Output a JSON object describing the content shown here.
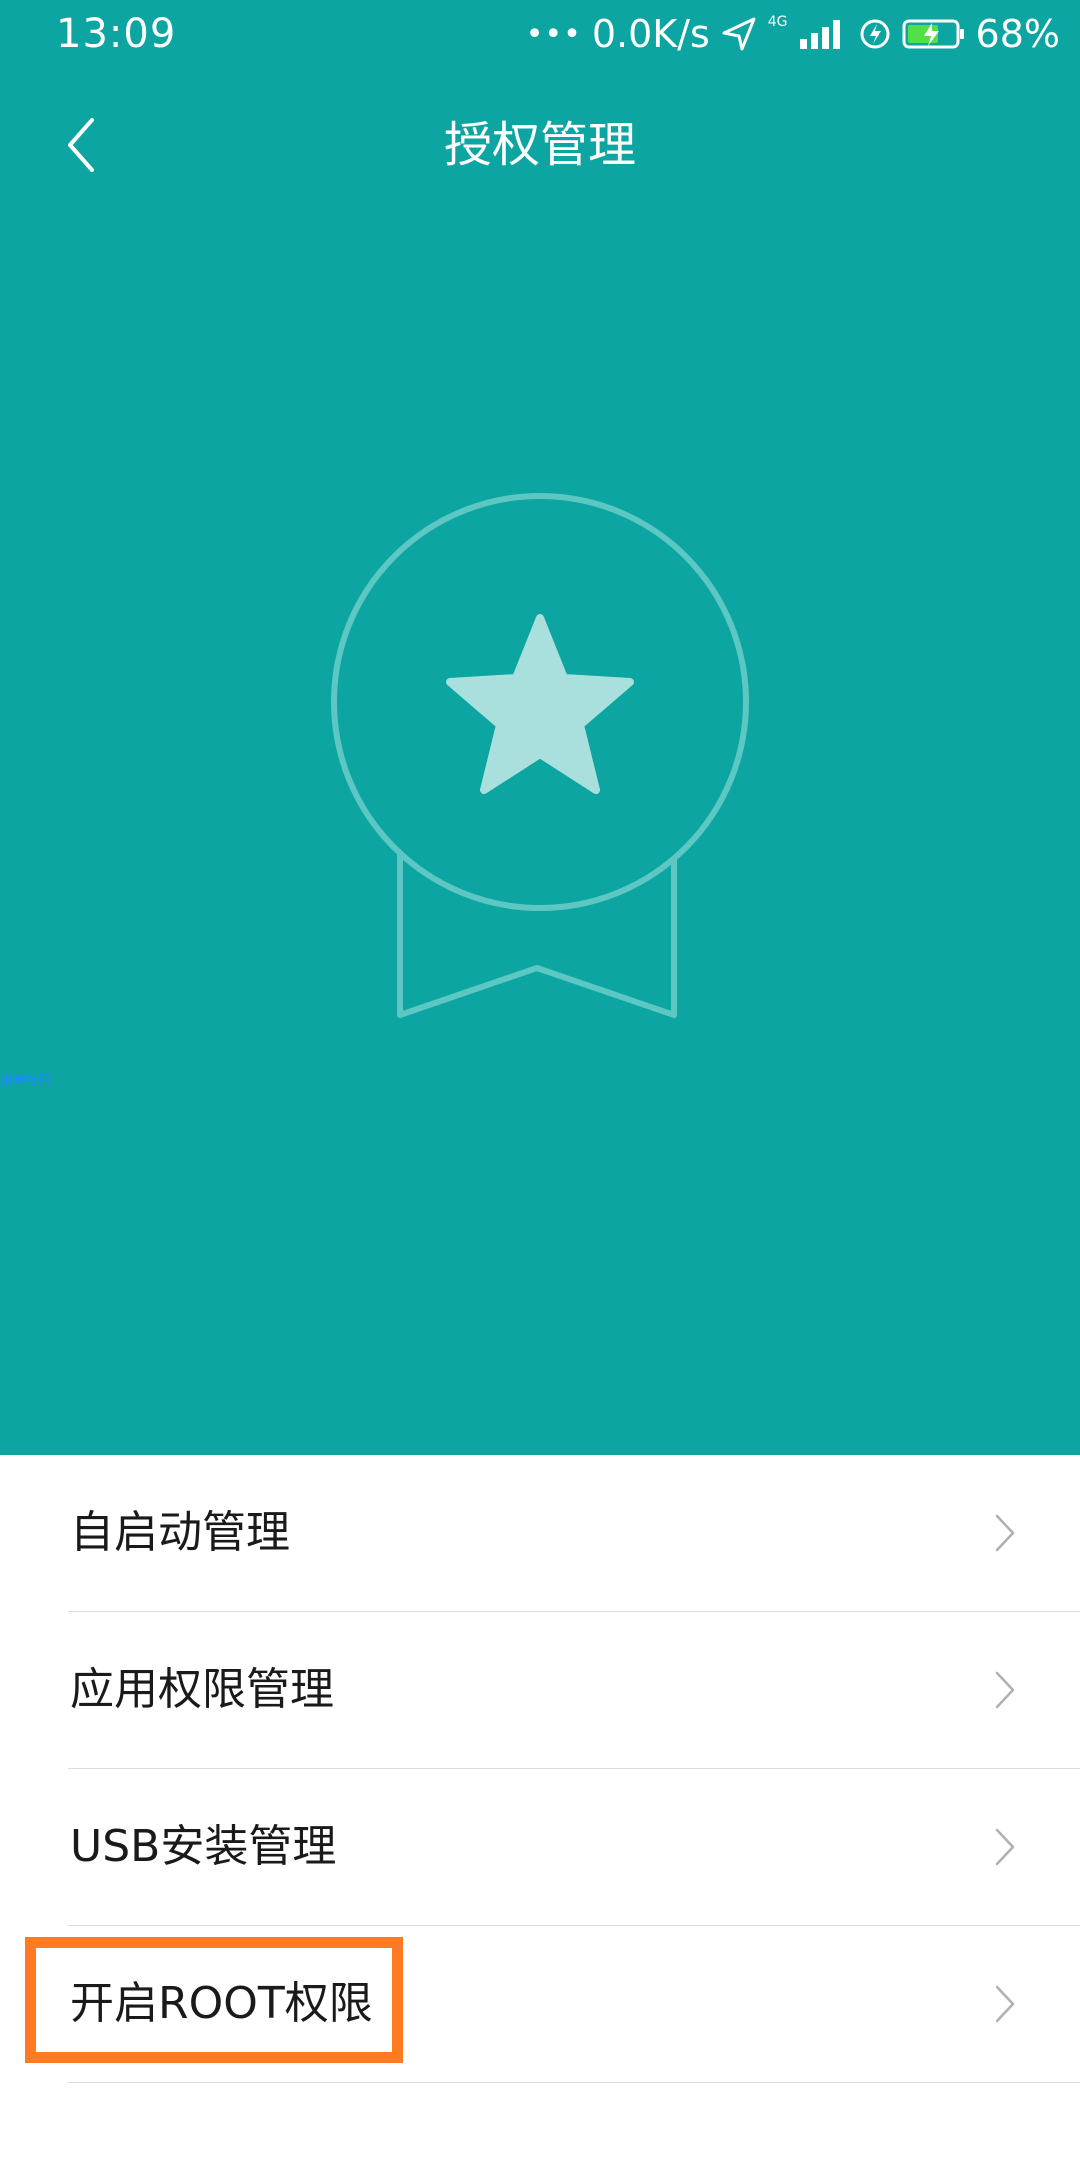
{
  "status_bar": {
    "time": "13:09",
    "dots": "•••",
    "net_speed": "0.0K/s",
    "network_type": "4G",
    "battery": "68%",
    "icons": [
      "location-arrow-icon",
      "signal-icon",
      "alarm-icon",
      "battery-charging-icon"
    ]
  },
  "header": {
    "title": "授权管理",
    "back_icon": "back-chevron-icon"
  },
  "hero": {
    "icon": "medal-star-icon",
    "watermark": "讲堂社区"
  },
  "menu": {
    "items": [
      {
        "label": "自启动管理",
        "icon": "chevron-right-icon"
      },
      {
        "label": "应用权限管理",
        "icon": "chevron-right-icon"
      },
      {
        "label": "USB安装管理",
        "icon": "chevron-right-icon"
      },
      {
        "label": "开启ROOT权限",
        "icon": "chevron-right-icon"
      }
    ]
  },
  "colors": {
    "header_bg": "#0ca5a2",
    "highlight": "#ff7a21",
    "badge_ring": "#5cc7c3",
    "badge_star": "#a9e0de"
  }
}
